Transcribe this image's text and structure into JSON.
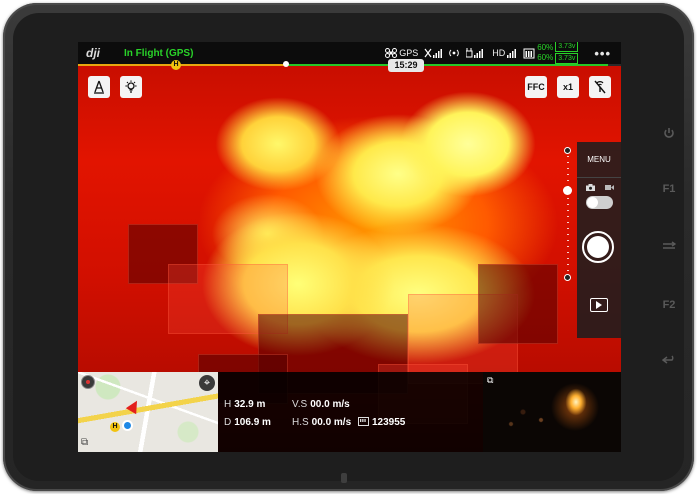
{
  "top_bar": {
    "logo": "dji",
    "flight_status": "In Flight (GPS)",
    "gps_label": "GPS",
    "hd_label": "HD",
    "battery_rc_pct": "60%",
    "battery_rc_volt": "3.73v",
    "battery_ac_pct": "60%",
    "battery_ac_volt": "3.73v",
    "more": "•••"
  },
  "timeline": {
    "home_marker": "H",
    "time": "15:29"
  },
  "buttons": {
    "ffc": "FFC",
    "zoom": "x1"
  },
  "right_rail": {
    "menu": "MENU"
  },
  "map": {
    "home_marker": "H"
  },
  "telemetry": {
    "h_label": "H",
    "h_value": "32.9 m",
    "vs_label": "V.S",
    "vs_value": "00.0 m/s",
    "d_label": "D",
    "d_value": "106.9 m",
    "hs_label": "H.S",
    "hs_value": "00.0 m/s",
    "counter_value": "123955"
  },
  "icons": {
    "drone": "drone-icon",
    "signal": "signal-icon",
    "wifi": "wireless-icon",
    "rc": "rc-signal-icon",
    "battery": "battery-icon",
    "camera": "camera-icon",
    "video": "video-icon",
    "playback": "playback-icon",
    "target": "crosshair-icon"
  },
  "colors": {
    "status_green": "#29d329",
    "home_yellow": "#f2c30f",
    "progress_orange": "#e8a70f",
    "pilot_blue": "#1e88e5"
  }
}
